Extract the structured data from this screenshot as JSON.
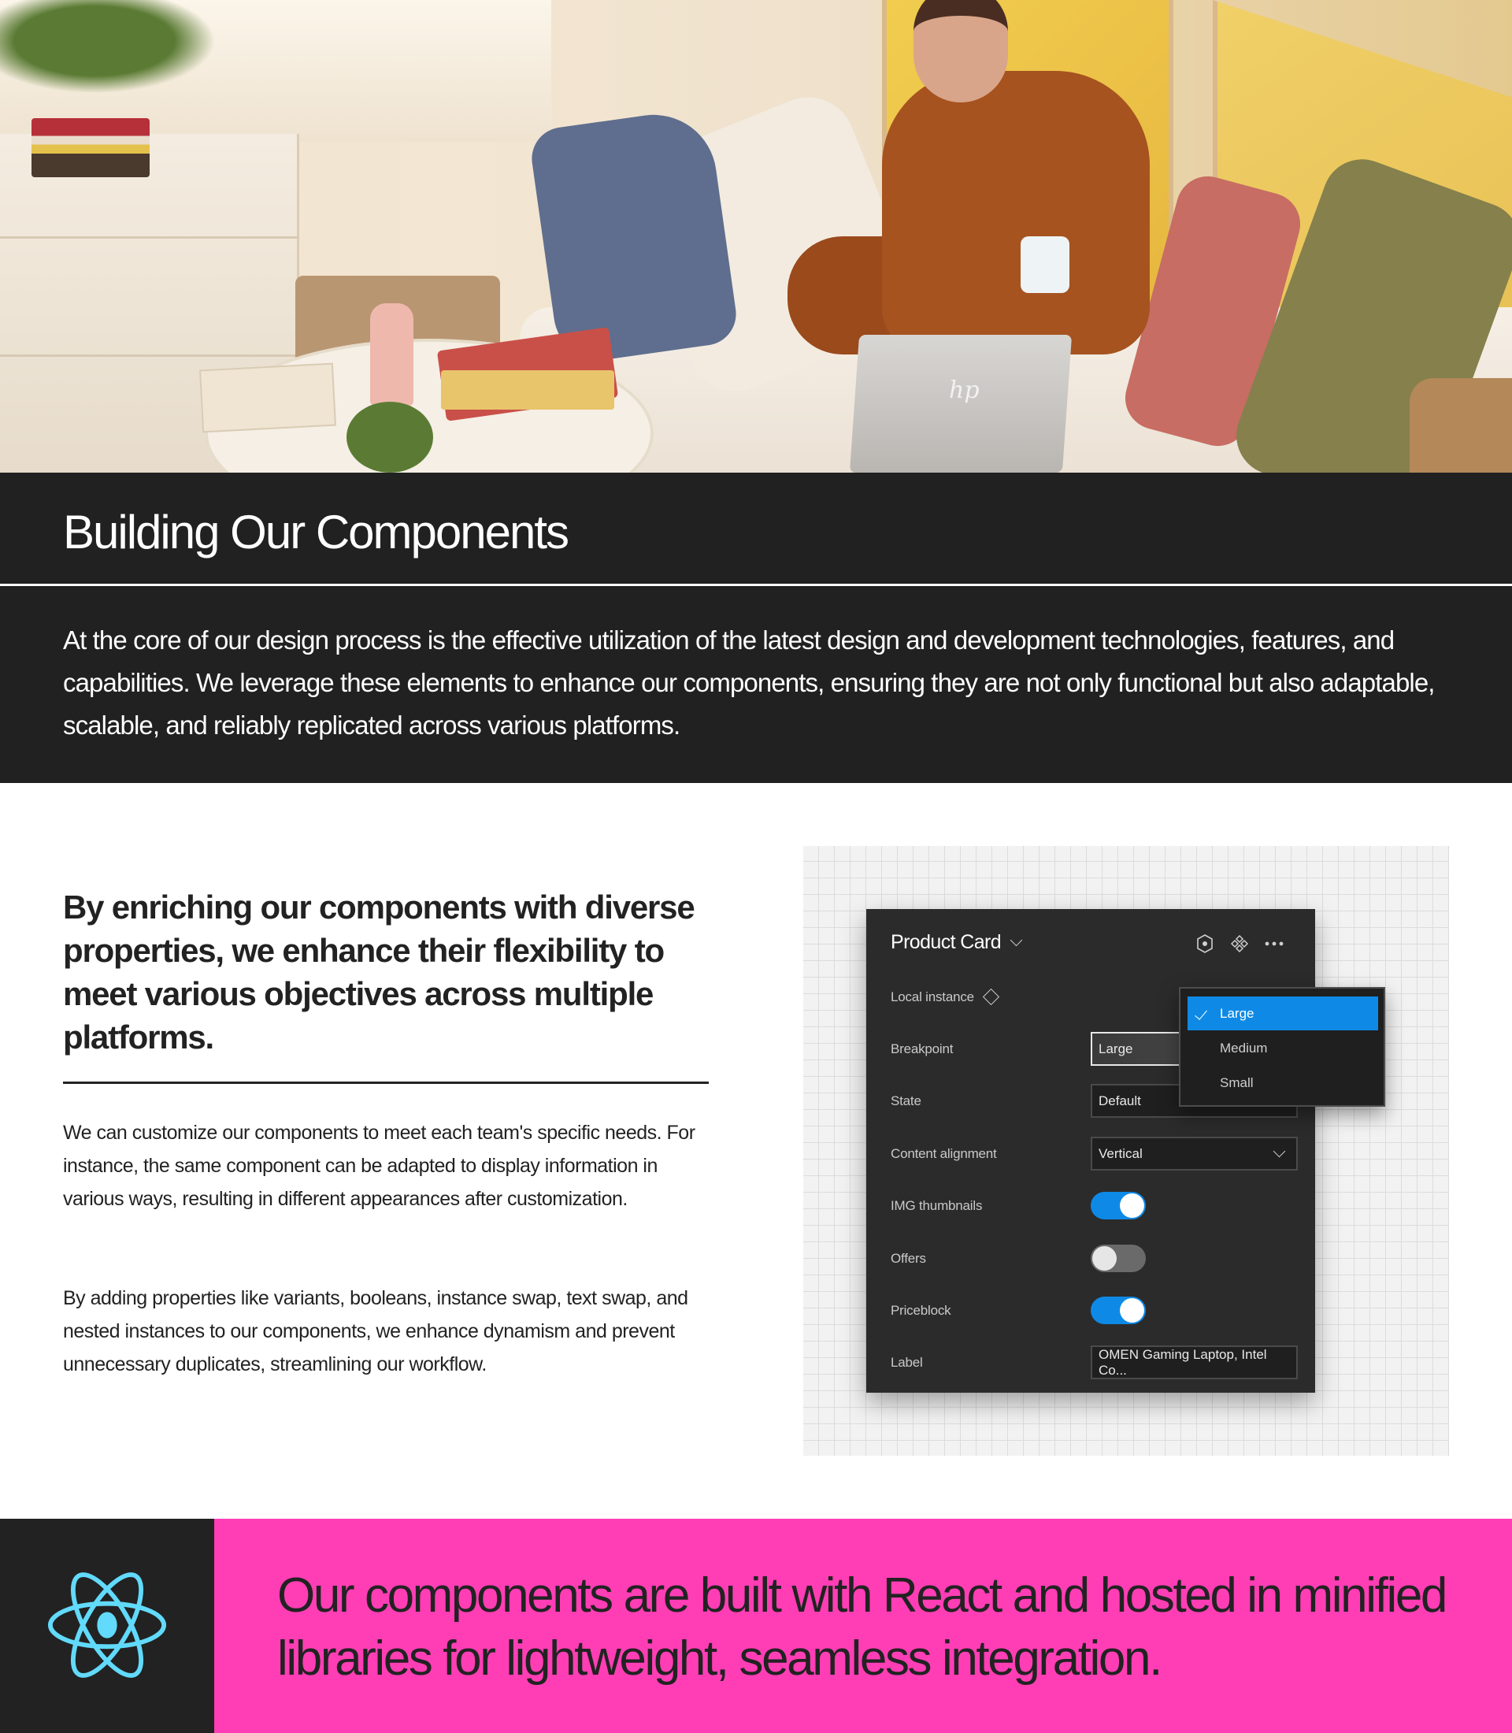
{
  "hero": {
    "image_alt": "Woman on sofa using HP laptop while on the phone",
    "laptop_logo": "hp"
  },
  "intro": {
    "title": "Building Our Components",
    "text": "At the core of our design process is the effective utilization of the latest design and development technologies, features, and capabilities. We leverage these elements to enhance our components, ensuring they are not only functional but also adaptable, scalable, and reliably replicated across various platforms."
  },
  "features": {
    "lead": "By enriching our components with diverse properties, we enhance their flexibility to meet various objectives across multiple platforms.",
    "paragraphs": [
      "We can customize our components to meet each team's specific needs. For instance, the same component can be adapted to display information in various ways, resulting in different appearances after customization.",
      "By adding properties like variants, booleans, instance swap, text swap, and nested instances to our components, we enhance dynamism and prevent unnecessary duplicates, streamlining our workflow."
    ]
  },
  "panel": {
    "title": "Product Card",
    "header_icons": [
      "instance-hexagon-icon",
      "component-icon",
      "more-options-icon"
    ],
    "local_instance_label": "Local instance",
    "properties": [
      {
        "label": "Breakpoint",
        "type": "select",
        "value": "Large"
      },
      {
        "label": "State",
        "type": "select",
        "value": "Default"
      },
      {
        "label": "Content alignment",
        "type": "select",
        "value": "Vertical"
      },
      {
        "label": "IMG thumbnails",
        "type": "toggle",
        "value": true
      },
      {
        "label": "Offers",
        "type": "toggle",
        "value": false
      },
      {
        "label": "Priceblock",
        "type": "toggle",
        "value": true
      },
      {
        "label": "Label",
        "type": "text",
        "value": "OMEN Gaming Laptop, Intel Co..."
      }
    ],
    "dropdown": {
      "options": [
        "Large",
        "Medium",
        "Small"
      ],
      "selected": "Large"
    },
    "colors": {
      "accent": "#0e8ae6",
      "panel_bg": "#2b2b2b"
    }
  },
  "banner": {
    "icon": "react-logo-icon",
    "text": "Our components are built with React and hosted in minified libraries for lightweight, seamless integration.",
    "colors": {
      "background": "#ff3eb5",
      "icon": "#61dafb",
      "icon_block": "#222222"
    }
  }
}
